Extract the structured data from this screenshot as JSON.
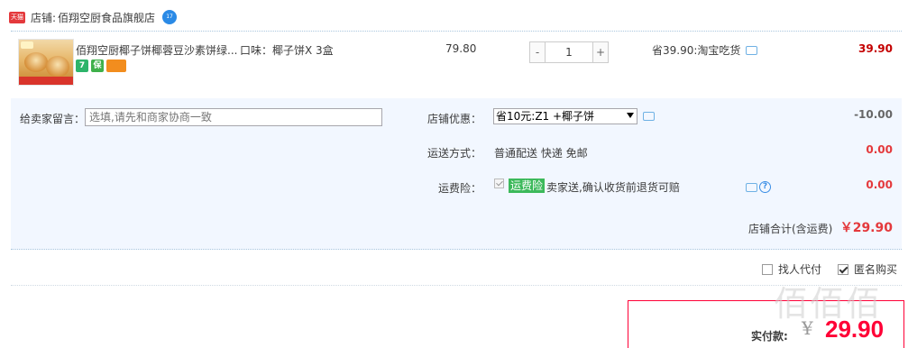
{
  "shop": {
    "badge": "天猫",
    "prefix": "店铺:",
    "name": "佰翔空厨食品旗舰店",
    "chat_badge": "17"
  },
  "item": {
    "title": "佰翔空厨椰子饼椰蓉豆沙素饼绿...",
    "flavor": "口味：椰子饼X 3盒",
    "service_icons": [
      "seven-day-return-icon",
      "guarantee-icon",
      "credit-card-icon"
    ],
    "service_labels": [
      "7",
      "保"
    ],
    "price": "79.80",
    "qty_minus": "-",
    "qty_value": "1",
    "qty_plus": "+",
    "savings": "省39.90:淘宝吃货",
    "subtotal": "39.90"
  },
  "options": {
    "note_label": "给卖家留言：",
    "note_placeholder": "选填,请先和商家协商一致",
    "promo_label": "店铺优惠：",
    "promo_selected": "省10元:Z1 +椰子饼",
    "promo_amount": "-10.00",
    "shipping_label": "运送方式：",
    "shipping_value": "普通配送 快递 免邮",
    "shipping_amount": "0.00",
    "insurance_label": "运费险：",
    "insurance_tag": "运费险",
    "insurance_text": "卖家送,确认收货前退货可赔",
    "insurance_amount": "0.00",
    "shop_total_label": "店铺合计(含运费)",
    "shop_total_value": "￥29.90"
  },
  "checkout": {
    "proxy_pay_label": "找人代付",
    "proxy_pay_checked": false,
    "anonymous_label": "匿名购买",
    "anonymous_checked": true,
    "pay_label": "实付款:",
    "pay_currency": "¥",
    "pay_amount": "29.90"
  },
  "watermark": "佰佰佰",
  "colors": {
    "accent_red": "#e4393c",
    "pay_red": "#ff0036",
    "panel_bg": "#f2f7ff",
    "link_blue": "#3a8ee6",
    "insurance_green": "#3cb95b"
  }
}
